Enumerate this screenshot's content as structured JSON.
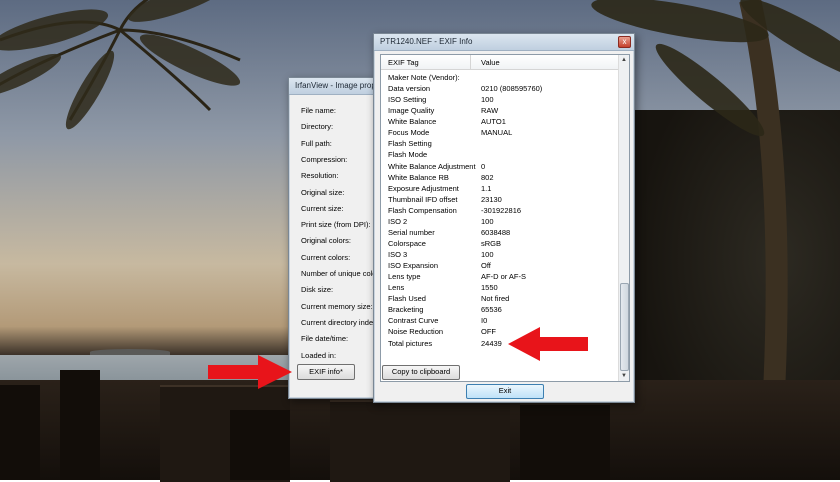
{
  "props_window": {
    "title": "IrfanView - Image prop",
    "fields": [
      "File name:",
      "Directory:",
      "Full path:",
      "Compression:",
      "Resolution:",
      "Original size:",
      "Current size:",
      "Print size (from DPI):",
      "Original colors:",
      "Current colors:",
      "Number of unique colo",
      "Disk size:",
      "Current memory size:",
      "Current directory index:",
      "File date/time:",
      "Loaded in:"
    ],
    "exif_button": "EXIF info*"
  },
  "exif_window": {
    "title": "PTR1240.NEF - EXIF Info",
    "columns": {
      "tag": "EXIF Tag",
      "value": "Value"
    },
    "rows": [
      {
        "tag": "Maker Note (Vendor):",
        "value": ""
      },
      {
        "tag": "Data version",
        "value": "0210 (808595760)"
      },
      {
        "tag": "ISO Setting",
        "value": "100"
      },
      {
        "tag": "Image Quality",
        "value": "RAW"
      },
      {
        "tag": "White Balance",
        "value": "AUTO1"
      },
      {
        "tag": "Focus Mode",
        "value": "MANUAL"
      },
      {
        "tag": "Flash Setting",
        "value": ""
      },
      {
        "tag": "Flash Mode",
        "value": ""
      },
      {
        "tag": "White Balance Adjustment",
        "value": "0"
      },
      {
        "tag": "White Balance RB",
        "value": "802"
      },
      {
        "tag": "Exposure Adjustment",
        "value": "1.1"
      },
      {
        "tag": "Thumbnail IFD offset",
        "value": "23130"
      },
      {
        "tag": "Flash Compensation",
        "value": "-301922816"
      },
      {
        "tag": "ISO 2",
        "value": "100"
      },
      {
        "tag": "Serial number",
        "value": "6038488"
      },
      {
        "tag": "Colorspace",
        "value": "sRGB"
      },
      {
        "tag": "ISO 3",
        "value": "100"
      },
      {
        "tag": "ISO Expansion",
        "value": "Off"
      },
      {
        "tag": "Lens type",
        "value": "AF-D or AF-S"
      },
      {
        "tag": "Lens",
        "value": "1550"
      },
      {
        "tag": "Flash Used",
        "value": "Not fired"
      },
      {
        "tag": "Bracketing",
        "value": "65536"
      },
      {
        "tag": "Contrast Curve",
        "value": "I0"
      },
      {
        "tag": "Noise Reduction",
        "value": "OFF"
      },
      {
        "tag": "Total pictures",
        "value": "24439"
      }
    ],
    "copy_button": "Copy to clipboard",
    "exit_button": "Exit",
    "close_glyph": "x"
  },
  "colors": {
    "arrow": "#e8141a",
    "exit_border": "#3c7fb1"
  }
}
